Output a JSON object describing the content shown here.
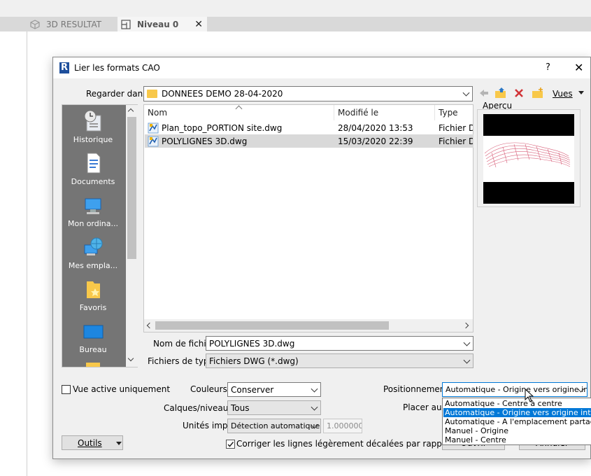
{
  "app": {
    "tabs": [
      {
        "label": "3D RESULTAT"
      },
      {
        "label": "Niveau 0"
      }
    ]
  },
  "dialog": {
    "title": "Lier les formats CAO",
    "help": "?",
    "close": "✕",
    "look_in_label": "Regarder dans:",
    "look_in_value": "DONNEES DEMO 28-04-2020",
    "views_label": "Vues",
    "preview_label": "Aperçu",
    "places": [
      {
        "label": "Historique"
      },
      {
        "label": "Documents"
      },
      {
        "label": "Mon ordina..."
      },
      {
        "label": "Mes empla..."
      },
      {
        "label": "Favoris"
      },
      {
        "label": "Bureau"
      }
    ],
    "columns": [
      "Nom",
      "Modifié le",
      "Type"
    ],
    "files": [
      {
        "name": "Plan_topo_PORTION site.dwg",
        "modified": "28/04/2020 13:53",
        "type": "Fichier DWG"
      },
      {
        "name": "POLYLIGNES 3D.dwg",
        "modified": "15/03/2020 22:39",
        "type": "Fichier DWG"
      }
    ],
    "filename_label": "Nom de fichier:",
    "filename_value": "POLYLIGNES 3D.dwg",
    "filetype_label": "Fichiers de type:",
    "filetype_value": "Fichiers DWG  (*.dwg)",
    "active_view_label": "Vue active uniquement",
    "colors_label": "Couleurs:",
    "colors_value": "Conserver",
    "layers_label": "Calques/niveaux:",
    "layers_value": "Tous",
    "units_label": "Unités imp.:",
    "units_value": "Détection automatique",
    "scale_value": "1.000000",
    "correct_lines_label": "Corriger les lignes légèrement décalées par rapport à l'axe",
    "positioning_label": "Positionnement:",
    "positioning_value": "Automatique - Origine vers origine inte",
    "place_at_label": "Placer au:",
    "tools_label": "Outils",
    "open_label": "Ouvrir",
    "cancel_label": "Annuler",
    "positioning_options": [
      "Automatique - Centre à centre",
      "Automatique - Origine vers origine interne",
      "Automatique - A l'emplacement partagé",
      "Manuel - Origine",
      "Manuel - Centre"
    ],
    "positioning_selected_index": 1
  },
  "colors": {
    "accent": "#0078d7",
    "error": "#d13438",
    "folder": "#f8c84a",
    "places_bg": "#757575"
  }
}
